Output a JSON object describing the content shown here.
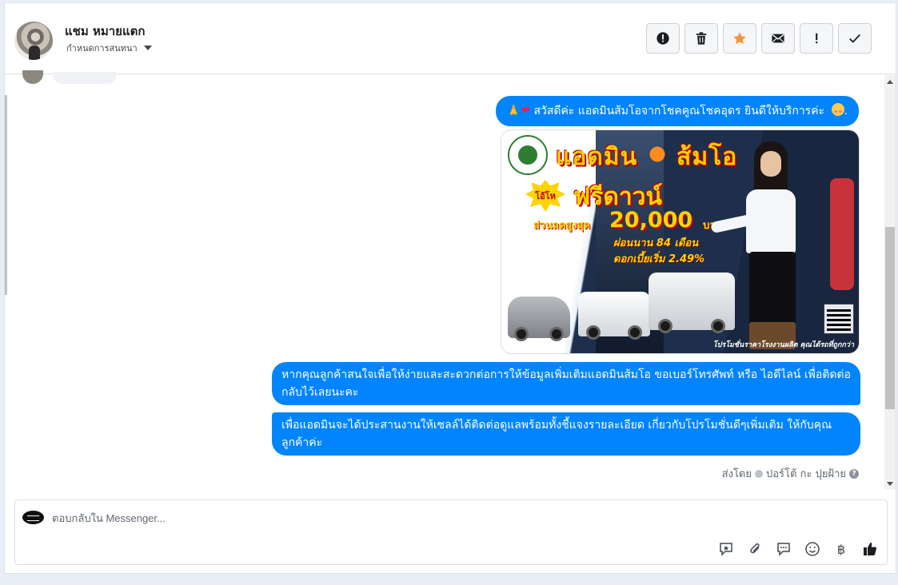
{
  "header": {
    "name": "แชม หมายแตก",
    "assign_label": "กำหนดการสนทนา",
    "actions": [
      {
        "name": "mark-spam-button",
        "icon": "exclamation-circle-icon"
      },
      {
        "name": "delete-button",
        "icon": "trash-icon"
      },
      {
        "name": "star-button",
        "icon": "star-icon"
      },
      {
        "name": "mark-unread-button",
        "icon": "envelope-icon"
      },
      {
        "name": "follow-up-button",
        "icon": "exclamation-icon"
      },
      {
        "name": "done-button",
        "icon": "check-icon"
      }
    ]
  },
  "thread": {
    "greeting": "สวัสดีค่ะ แอดมินส้มโอจากโชคคูณโชคอุดร ยินดีให้บริการค่ะ",
    "greeting_suffix": ".",
    "promo": {
      "title": "แอดมิน",
      "title_2": "ส้มโอ",
      "hot_label": "โอ้โห",
      "headline": "ฟรีดาวน์",
      "discount_label": "ส่วนลดสูงสุด",
      "discount_amount": "20,000",
      "currency": "บาท",
      "installment": "ผ่อนนาน 84 เดือน",
      "interest": "ดอกเบี้ยเริ่ม 2.49%",
      "footer": "โปรโมชั่นราคาโรงงานผลิต คุณได้รถที่ถูกกว่า"
    },
    "message_2": "หากคุณลูกค้าสนใจเพื่อให้ง่ายและสะดวกต่อการให้ข้อมูลเพิ่มเติมแอดมินส้มโอ ขอเบอร์โทรศัพท์ หรือ ไอดีไลน์ เพื่อติดต่อกลับไว้เลยนะคะ",
    "message_3": "เพื่อแอดมินจะได้ประสานงานให้เซลล์ได้ติดต่อดูแลพร้อมทั้งชี้แจงรายละเอียด เกี่ยวกับโปรโมชั่นดีๆเพิ่มเติม ให้กับคุณลูกค้าค่ะ",
    "sent_by_label": "ส่งโดย",
    "sent_by_name": "ปอร์โต้ กะ ปุยฝ้าย",
    "help": "?"
  },
  "composer": {
    "placeholder": "ตอบกลับใน Messenger...",
    "value": "",
    "tools": [
      {
        "name": "saved-reply-icon"
      },
      {
        "name": "attachment-icon"
      },
      {
        "name": "chat-bubble-icon"
      },
      {
        "name": "emoji-icon"
      },
      {
        "name": "baht-icon",
        "glyph": "฿"
      },
      {
        "name": "like-icon"
      }
    ]
  },
  "colors": {
    "bubble": "#0084ff",
    "star": "#f7923a",
    "like": "#1c1e21"
  }
}
